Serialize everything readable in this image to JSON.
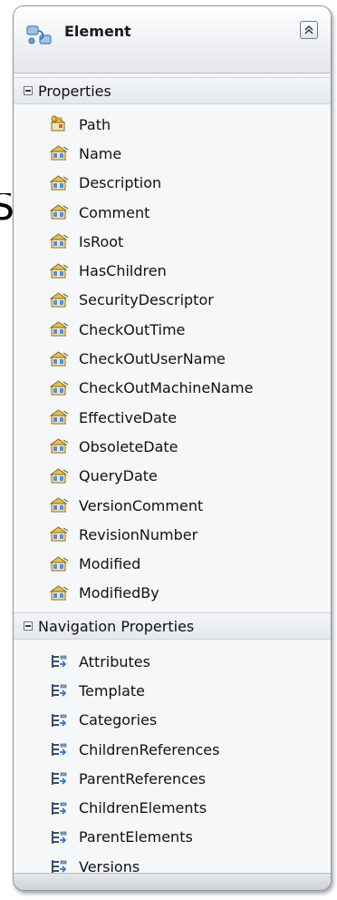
{
  "entity": {
    "title": "Element",
    "icon": "entity-icon",
    "collapse_icon": "double-chevron-up-icon"
  },
  "properties": {
    "header": "Properties",
    "items": [
      {
        "label": "Path",
        "icon": "key-property-icon"
      },
      {
        "label": "Name",
        "icon": "property-icon"
      },
      {
        "label": "Description",
        "icon": "property-icon"
      },
      {
        "label": "Comment",
        "icon": "property-icon"
      },
      {
        "label": "IsRoot",
        "icon": "property-icon"
      },
      {
        "label": "HasChildren",
        "icon": "property-icon"
      },
      {
        "label": "SecurityDescriptor",
        "icon": "property-icon"
      },
      {
        "label": "CheckOutTime",
        "icon": "property-icon"
      },
      {
        "label": "CheckOutUserName",
        "icon": "property-icon"
      },
      {
        "label": "CheckOutMachineName",
        "icon": "property-icon"
      },
      {
        "label": "EffectiveDate",
        "icon": "property-icon"
      },
      {
        "label": "ObsoleteDate",
        "icon": "property-icon"
      },
      {
        "label": "QueryDate",
        "icon": "property-icon"
      },
      {
        "label": "VersionComment",
        "icon": "property-icon"
      },
      {
        "label": "RevisionNumber",
        "icon": "property-icon"
      },
      {
        "label": "Modified",
        "icon": "property-icon"
      },
      {
        "label": "ModifiedBy",
        "icon": "property-icon"
      }
    ]
  },
  "navigation": {
    "header": "Navigation Properties",
    "items": [
      {
        "label": "Attributes",
        "icon": "navigation-property-icon"
      },
      {
        "label": "Template",
        "icon": "navigation-property-icon"
      },
      {
        "label": "Categories",
        "icon": "navigation-property-icon"
      },
      {
        "label": "ChildrenReferences",
        "icon": "navigation-property-icon"
      },
      {
        "label": "ParentReferences",
        "icon": "navigation-property-icon"
      },
      {
        "label": "ChildrenElements",
        "icon": "navigation-property-icon"
      },
      {
        "label": "ParentElements",
        "icon": "navigation-property-icon"
      },
      {
        "label": "Versions",
        "icon": "navigation-property-icon"
      }
    ]
  },
  "colors": {
    "border": "#8f979f",
    "panel_bg": "#f6f7f8",
    "text": "#111111"
  }
}
